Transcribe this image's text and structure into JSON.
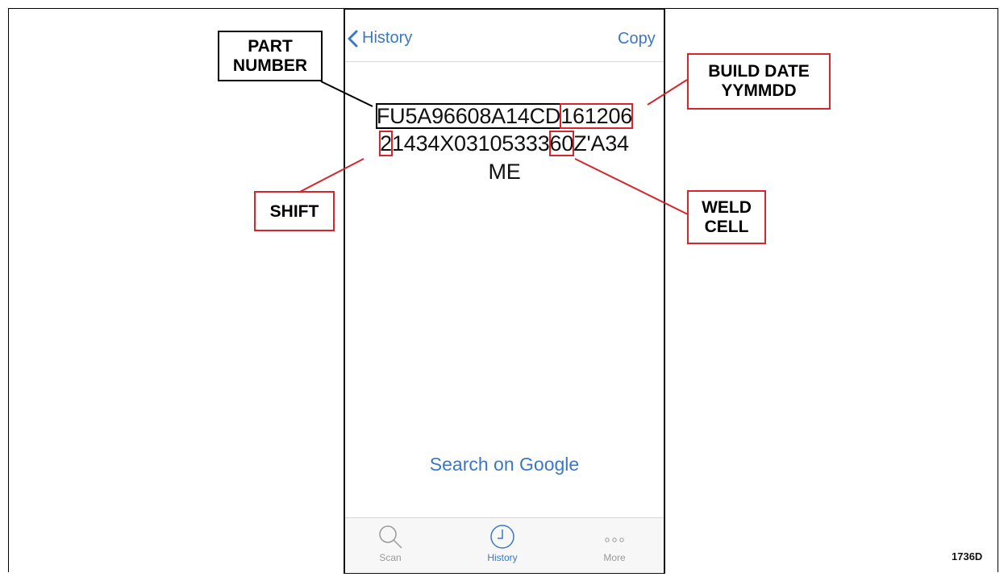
{
  "nav": {
    "back_label": "History",
    "copy_label": "Copy"
  },
  "barcode": {
    "line1_part": "FU5A96608A14CD",
    "line1_date": "161206",
    "line2_shift": "2",
    "line2_mid": "1434X03105333",
    "line2_weld": "60",
    "line2_end": "Z'A34",
    "line3": "ME"
  },
  "search_link": "Search on Google",
  "tabs": [
    {
      "label": "Scan",
      "icon": "magnifier-icon",
      "active": false
    },
    {
      "label": "History",
      "icon": "clock-icon",
      "active": true
    },
    {
      "label": "More",
      "icon": "ellipsis-icon",
      "active": false
    }
  ],
  "callouts": {
    "part_number": "PART\nNUMBER",
    "build_date": "BUILD DATE\nYYMMDD",
    "shift": "SHIFT",
    "weld_cell": "WELD\nCELL"
  },
  "figure_id": "1736D",
  "colors": {
    "accent": "#3b78c4",
    "callout_red": "#d6252b",
    "callout_black": "#000000"
  }
}
